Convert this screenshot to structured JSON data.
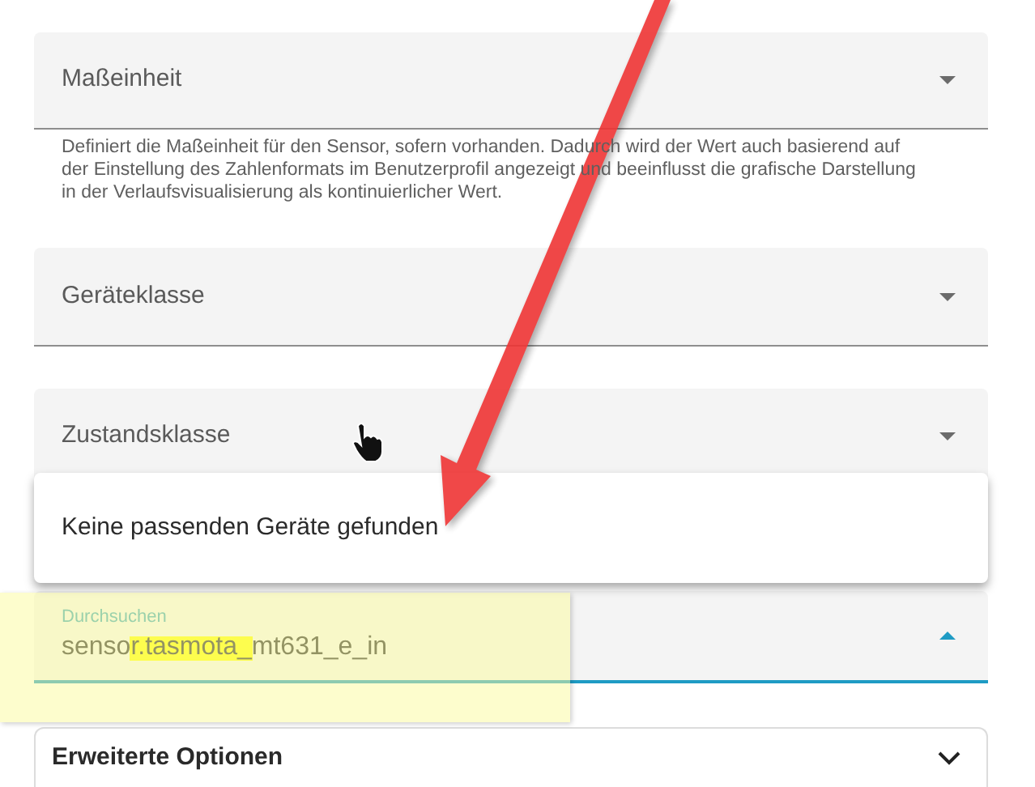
{
  "fields": [
    {
      "label": "Maßeinheit",
      "helper": "Definiert die Maßeinheit für den Sensor, sofern vorhanden. Dadurch wird der Wert auch basierend auf der Einstellung des Zahlenformats im Benutzerprofil angezeigt und beeinflusst die grafische Darstellung in der Verlaufsvisualisierung als kontinuierlicher Wert."
    },
    {
      "label": "Geräteklasse"
    },
    {
      "label": "Zustandsklasse"
    }
  ],
  "dropdown": {
    "message": "Keine passenden Geräte gefunden"
  },
  "search": {
    "label": "Durchsuchen",
    "value": "sensor.tasmota_mt631_e_in"
  },
  "advanced": {
    "title": "Erweiterte Optionen",
    "expanded": false
  }
}
